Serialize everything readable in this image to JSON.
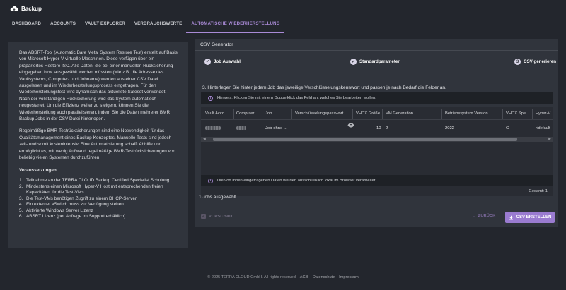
{
  "app": {
    "title": "Backup"
  },
  "tabs": [
    {
      "label": "DASHBOARD"
    },
    {
      "label": "ACCOUNTS"
    },
    {
      "label": "VAULT EXPLORER"
    },
    {
      "label": "VERBRAUCHSWERTE"
    },
    {
      "label": "AUTOMATISCHE WIEDERHERSTELLUNG"
    }
  ],
  "left": {
    "paragraph1": "Das ABSRT-Tool (Automatic Bare Metal System Restore Test) erstellt auf Basis von Microsoft Hyper-V virtuelle Maschinen. Diese verfügen über ein präpariertes Restore ISO. Alle Daten, die bei einer manuellen Rücksicherung eingegeben bzw. ausgewählt werden müssten (wie z.B. die Adresse des Vaultsystems, Computer- und Jobname) werden aus einer CSV Datei ausgelesen und im Wiederherstellungsprocess eingetragen. Für den Wiederherstellungstest wird dynamisch das aktuellste Safeset verwendet. Nach der vollständigen Rücksicherung wird das System automatisch neugestartet. Um die Effizienz weiter zu steigern, können Sie die Wiederherstellung auch parallelisieren, indem Sie die Daten mehrerer BMR Backup Jobs in der CSV Datei hinterlegen.",
    "paragraph2": "Regelmäßige BMR-Testrücksicherungen sind eine Notwendigkeit für das Qualitätsmanagement eines Backup-Konzeptes. Manuelle Tests sind jedoch zeit- und somit kostenintensiv. Eine Automatisierung schafft Abhilfe und ermöglicht es, mit wenig Aufwand regelmäßige BMR-Testrücksicherungen von beliebig vielen Systemen durchzuführen.",
    "requirements_title": "Voraussetzungen",
    "requirements": [
      {
        "num": "1.",
        "text": "Teilnahme an der TERRA CLOUD Backup Certified Specialist Schulung"
      },
      {
        "num": "2.",
        "text": "Mindestens einen Microsoft Hyper-V Host mit entsprechenden freien Kapazitäten für die Test-VMs"
      },
      {
        "num": "3.",
        "text": "Die Test-VMs benötigen Zugriff zu einem DHCP-Server"
      },
      {
        "num": "4.",
        "text": "Ein externer vSwitch muss zur Verfügung stehen"
      },
      {
        "num": "5.",
        "text": "Aktivierte Windows Server Lizenz"
      },
      {
        "num": "6.",
        "text": "ABSRT Lizenz (per Anfrage im Support erhältlich)"
      }
    ]
  },
  "csv": {
    "title": "CSV Generator",
    "steps": [
      {
        "num": "✓",
        "label": "Job Auswahl"
      },
      {
        "num": "✓",
        "label": "Standardparameter"
      },
      {
        "num": "3",
        "label": "CSV generieren"
      }
    ],
    "instruction": "3. Hinterlegen Sie hinter jedem Job das jeweilige Verschlüsselungskennwort und passen je nach Bedarf die Felder an.",
    "hint": "Hinweis: Klicken Sie mit einem Doppelklick das Feld an, welches Sie bearbeiten wollen.",
    "columns": [
      "Vault Acco...",
      "Computer",
      "Job",
      "Verschlüsselungspasswort",
      "VHDX Größe",
      "VM Generation",
      "Betriebssystem Version",
      "VHDX Spei...",
      "Hyper-V"
    ],
    "row": {
      "job": "Job-ohne-...",
      "vhdx_size": "10",
      "vm_generation": "2",
      "os_version": "2022",
      "vhdx_storage": "C",
      "hyperv": "<default"
    },
    "total": "Gesamt: 1",
    "privacy": "Die von Ihnen eingetragenen Daten werden ausschließlich lokal im Browser verarbeitet.",
    "selected": "1 Jobs ausgewählt",
    "preview_label": "VORSCHAU",
    "back_label": "ZURÜCK",
    "create_label": "CSV ERSTELLEN"
  },
  "footer": {
    "copyright": "© 2025 TERRA CLOUD GmbH. All rights reserved –",
    "agb": "AGB",
    "sep1": "–",
    "datenschutz": "Datenschutz",
    "sep2": "–",
    "impressum": "Impressum"
  }
}
